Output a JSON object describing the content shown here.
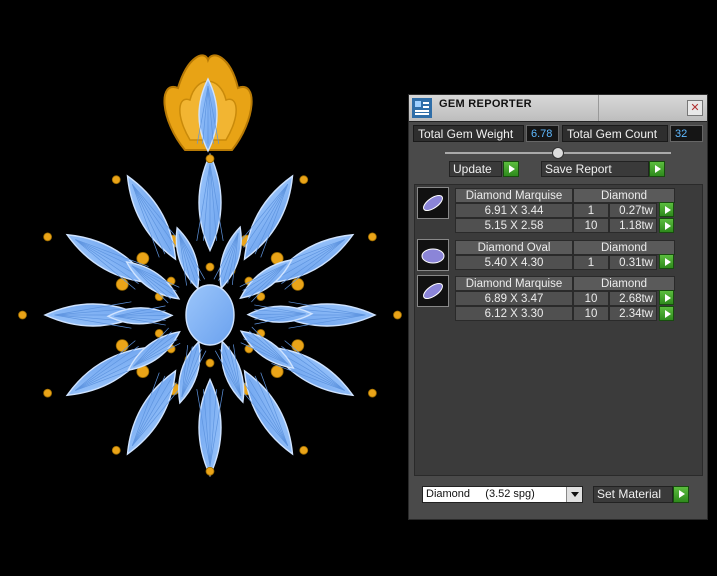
{
  "window": {
    "title": "GEM REPORTER"
  },
  "stats": {
    "total_weight_label": "Total Gem Weight",
    "total_weight_value": "6.78",
    "total_count_label": "Total Gem Count",
    "total_count_value": "32"
  },
  "buttons": {
    "update": "Update",
    "save_report": "Save Report",
    "set_material": "Set Material"
  },
  "groups": [
    {
      "shape": "Diamond Marquise",
      "material": "Diamond",
      "rows": [
        {
          "size": "6.91 X 3.44",
          "count": "1",
          "weight": "0.27tw"
        },
        {
          "size": "5.15 X 2.58",
          "count": "10",
          "weight": "1.18tw"
        }
      ]
    },
    {
      "shape": "Diamond Oval",
      "material": "Diamond",
      "rows": [
        {
          "size": "5.40 X 4.30",
          "count": "1",
          "weight": "0.31tw"
        }
      ]
    },
    {
      "shape": "Diamond Marquise",
      "material": "Diamond",
      "rows": [
        {
          "size": "6.89 X 3.47",
          "count": "10",
          "weight": "2.68tw"
        },
        {
          "size": "6.12 X 3.30",
          "count": "10",
          "weight": "2.34tw"
        }
      ]
    }
  ],
  "material_select": {
    "selected": "Diamond     (3.52 spg)"
  },
  "colors": {
    "gem_blue": "#7fb2f5",
    "gold": "#e8a315",
    "panel_bg": "#4a4a4a",
    "go_green": "#3ea128"
  }
}
